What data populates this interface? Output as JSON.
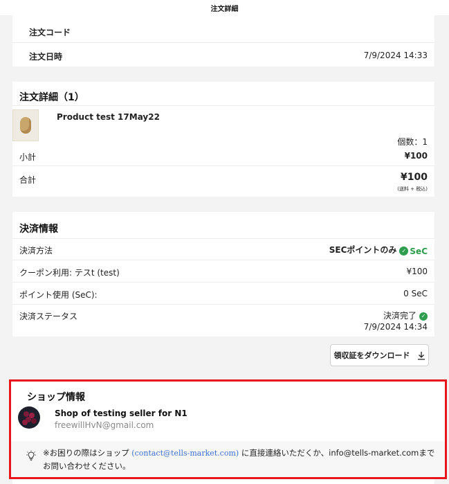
{
  "page_title": "注文詳細",
  "order": {
    "code_label": "注文コード",
    "code_value": "",
    "date_label": "注文日時",
    "date_value": "7/9/2024 14:33"
  },
  "details": {
    "title": "注文詳細（1）",
    "product_name": "Product test 17May22",
    "quantity": "個数：1",
    "subtotal_label": "小計",
    "subtotal_value": "¥100",
    "total_label": "合計",
    "total_value": "¥100",
    "total_note": "(送料 + 税込)"
  },
  "payment": {
    "title": "決済情報",
    "method_label": "決済方法",
    "method_value": "SECポイントのみ",
    "method_badge": "SeC",
    "coupon_label": "クーポン利用: テスt (test)",
    "coupon_value": "¥100",
    "points_label": "ポイント使用 (SeC):",
    "points_value": "0 SeC",
    "status_label": "決済ステータス",
    "status_value": "決済完了",
    "status_date": "7/9/2024 14:34"
  },
  "receipt_button": "領収証をダウンロード",
  "shop": {
    "title": "ショップ情報",
    "name": "Shop of testing seller for N1",
    "email": "freewillHvN@gmail.com",
    "notice_prefix": "※お困りの際はショップ",
    "notice_link": "(contact@tells-market.com)",
    "notice_suffix": "に直接連絡いただくか、info@tells-market.comま",
    "notice_line2_prefix": "で",
    "notice_line2": "お問い合わせください。"
  },
  "colors": {
    "accent_green": "#2e9e4e",
    "highlight_red": "#e8141c",
    "link_blue": "#3d6fd1"
  },
  "icons": {
    "sec": "sec-coin-icon",
    "status": "check-circle-icon",
    "download": "download-icon",
    "bulb": "lightbulb-icon"
  }
}
